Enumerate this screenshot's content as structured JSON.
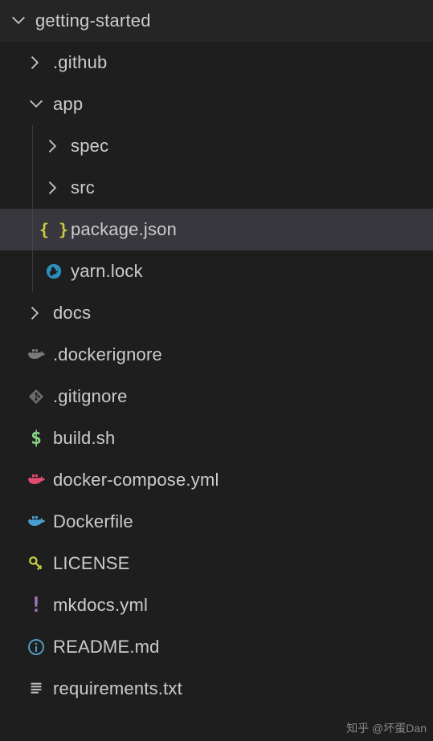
{
  "root": {
    "name": "getting-started",
    "expanded": true
  },
  "tree": [
    {
      "id": "github",
      "label": ".github",
      "type": "folder",
      "depth": 1,
      "expanded": false,
      "icon": "chevron"
    },
    {
      "id": "app",
      "label": "app",
      "type": "folder",
      "depth": 1,
      "expanded": true,
      "icon": "chevron"
    },
    {
      "id": "spec",
      "label": "spec",
      "type": "folder",
      "depth": 2,
      "expanded": false,
      "icon": "chevron",
      "guides": [
        1
      ]
    },
    {
      "id": "src",
      "label": "src",
      "type": "folder",
      "depth": 2,
      "expanded": false,
      "icon": "chevron",
      "guides": [
        1
      ]
    },
    {
      "id": "pkgjson",
      "label": "package.json",
      "type": "file",
      "depth": 2,
      "icon": "json",
      "selected": true,
      "guides": [
        1
      ]
    },
    {
      "id": "yarnlock",
      "label": "yarn.lock",
      "type": "file",
      "depth": 2,
      "icon": "yarn",
      "guides": [
        1
      ]
    },
    {
      "id": "docs",
      "label": "docs",
      "type": "folder",
      "depth": 1,
      "expanded": false,
      "icon": "chevron"
    },
    {
      "id": "dignore",
      "label": ".dockerignore",
      "type": "file",
      "depth": 1,
      "icon": "docker-grey"
    },
    {
      "id": "gignore",
      "label": ".gitignore",
      "type": "file",
      "depth": 1,
      "icon": "git-grey"
    },
    {
      "id": "build",
      "label": "build.sh",
      "type": "file",
      "depth": 1,
      "icon": "dollar"
    },
    {
      "id": "compose",
      "label": "docker-compose.yml",
      "type": "file",
      "depth": 1,
      "icon": "docker-pink"
    },
    {
      "id": "dfile",
      "label": "Dockerfile",
      "type": "file",
      "depth": 1,
      "icon": "docker-blue"
    },
    {
      "id": "license",
      "label": "LICENSE",
      "type": "file",
      "depth": 1,
      "icon": "key"
    },
    {
      "id": "mkdocs",
      "label": "mkdocs.yml",
      "type": "file",
      "depth": 1,
      "icon": "bang"
    },
    {
      "id": "readme",
      "label": "README.md",
      "type": "file",
      "depth": 1,
      "icon": "info"
    },
    {
      "id": "reqs",
      "label": "requirements.txt",
      "type": "file",
      "depth": 1,
      "icon": "lines"
    }
  ],
  "watermark": "知乎 @坏蛋Dan"
}
